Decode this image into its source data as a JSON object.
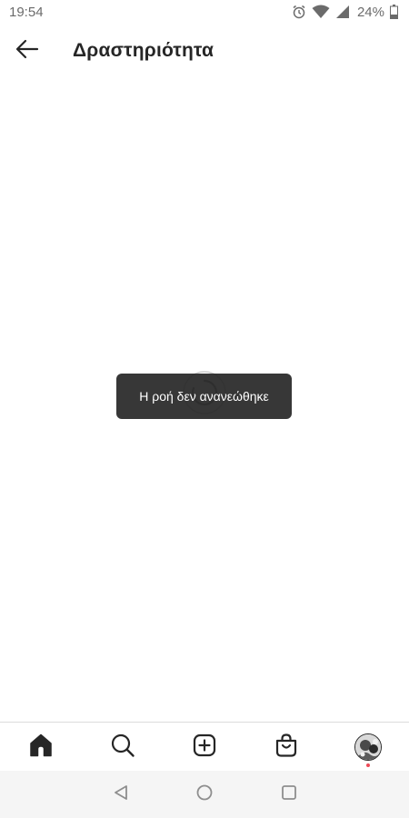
{
  "status_bar": {
    "time": "19:54",
    "battery_percent": "24%",
    "icons": [
      "alarm-icon",
      "wifi-icon",
      "signal-icon",
      "battery-icon"
    ]
  },
  "header": {
    "title": "Δραστηριότητα",
    "back_icon": "arrow-left-icon"
  },
  "content": {
    "loading": true,
    "spinner_icon": "refresh-spinner-icon"
  },
  "toast": {
    "message": "Η ροή δεν ανανεώθηκε"
  },
  "bottom_nav": {
    "items": [
      {
        "icon": "home-icon",
        "active": true
      },
      {
        "icon": "search-icon",
        "active": false
      },
      {
        "icon": "add-post-icon",
        "active": false
      },
      {
        "icon": "shop-bag-icon",
        "active": false
      },
      {
        "icon": "profile-avatar",
        "active": false,
        "has_notification": true
      }
    ]
  },
  "system_nav": {
    "buttons": [
      "back-triangle-icon",
      "home-circle-icon",
      "recents-square-icon"
    ]
  },
  "colors": {
    "text_primary": "#262626",
    "toast_bg": "#262626",
    "notification_dot": "#ed4956",
    "divider": "#dbdbdb",
    "system_nav_bg": "#f5f5f5"
  }
}
